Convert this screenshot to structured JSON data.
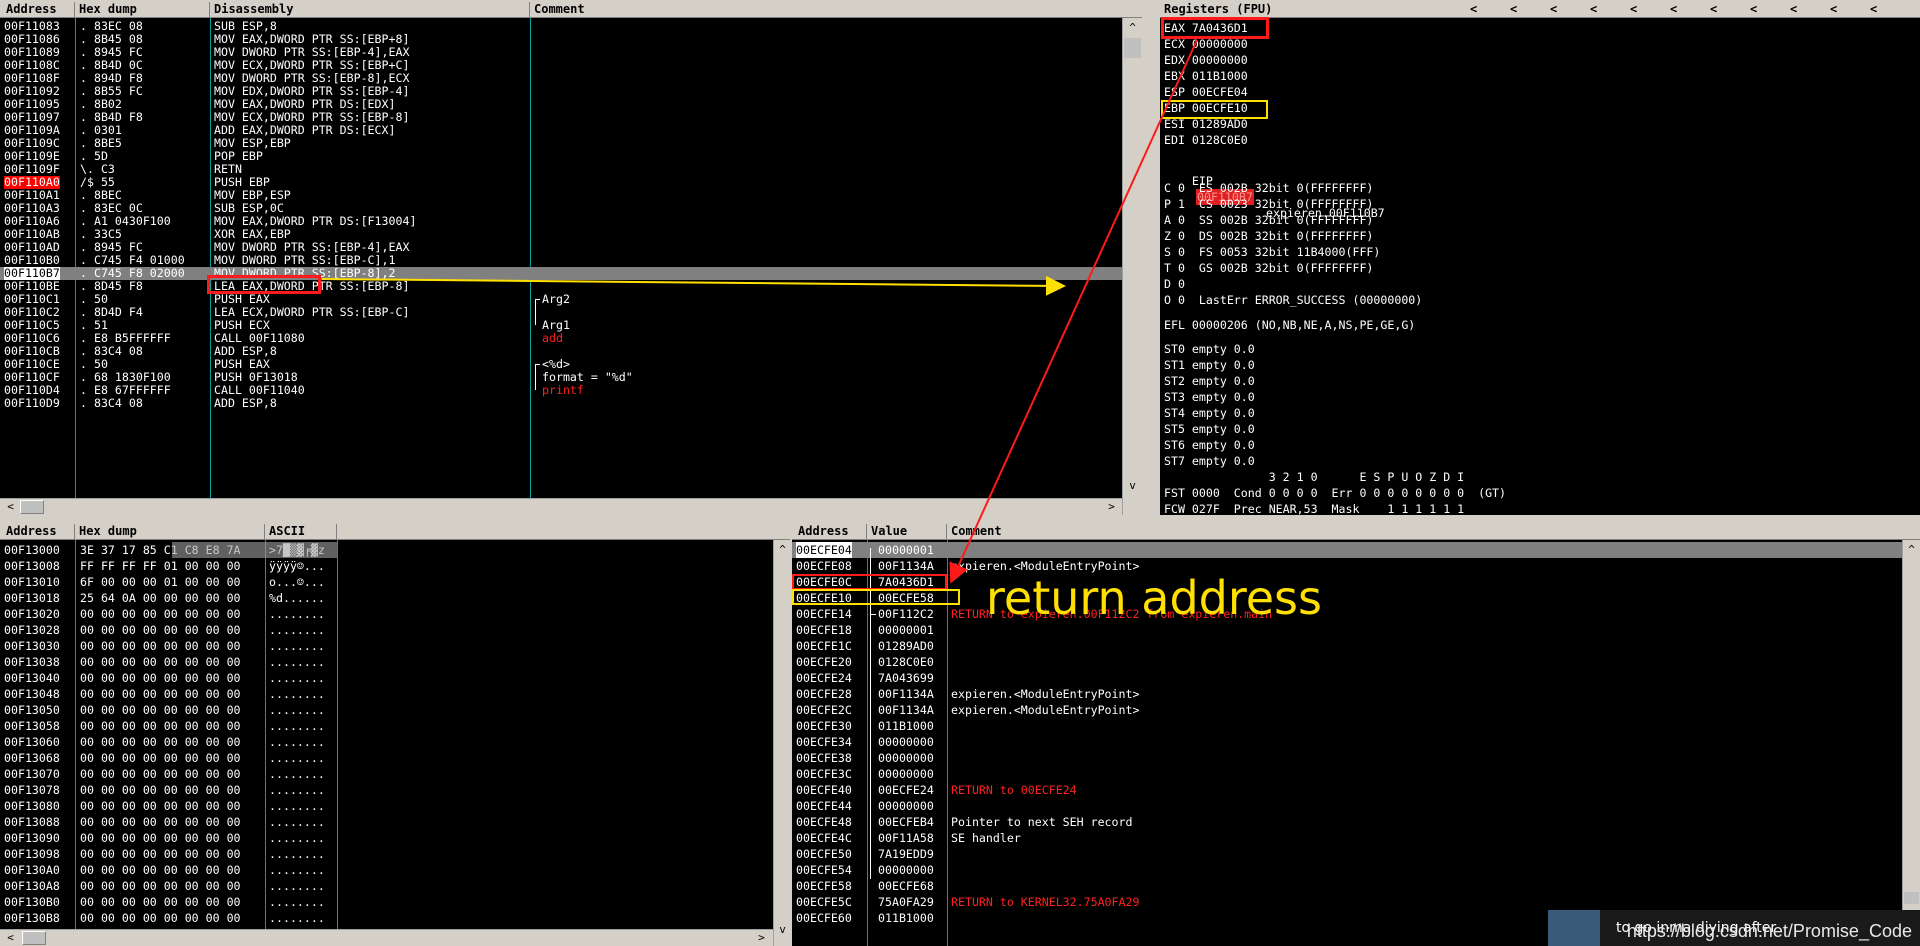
{
  "disasm": {
    "headers": [
      "Address",
      "Hex dump",
      "Disassembly",
      "Comment"
    ],
    "rows": [
      {
        "addr": "00F11083",
        "hex": ". 83EC 08",
        "asm": "SUB ESP,8",
        "comment": ""
      },
      {
        "addr": "00F11086",
        "hex": ". 8B45 08",
        "asm": "MOV EAX,DWORD PTR SS:[EBP+8]",
        "comment": ""
      },
      {
        "addr": "00F11089",
        "hex": ". 8945 FC",
        "asm": "MOV DWORD PTR SS:[EBP-4],EAX",
        "comment": ""
      },
      {
        "addr": "00F1108C",
        "hex": ". 8B4D 0C",
        "asm": "MOV ECX,DWORD PTR SS:[EBP+C]",
        "comment": ""
      },
      {
        "addr": "00F1108F",
        "hex": ". 894D F8",
        "asm": "MOV DWORD PTR SS:[EBP-8],ECX",
        "comment": ""
      },
      {
        "addr": "00F11092",
        "hex": ". 8B55 FC",
        "asm": "MOV EDX,DWORD PTR SS:[EBP-4]",
        "comment": ""
      },
      {
        "addr": "00F11095",
        "hex": ". 8B02",
        "asm": "MOV EAX,DWORD PTR DS:[EDX]",
        "comment": ""
      },
      {
        "addr": "00F11097",
        "hex": ". 8B4D F8",
        "asm": "MOV ECX,DWORD PTR SS:[EBP-8]",
        "comment": ""
      },
      {
        "addr": "00F1109A",
        "hex": ". 0301",
        "asm": "ADD EAX,DWORD PTR DS:[ECX]",
        "comment": ""
      },
      {
        "addr": "00F1109C",
        "hex": ". 8BE5",
        "asm": "MOV ESP,EBP",
        "comment": ""
      },
      {
        "addr": "00F1109E",
        "hex": ". 5D",
        "asm": "POP EBP",
        "comment": ""
      },
      {
        "addr": "00F1109F",
        "hex": "\\. C3",
        "asm": "RETN",
        "comment": ""
      },
      {
        "addr": "00F110A0",
        "hex": "/$ 55",
        "asm": "PUSH EBP",
        "comment": ""
      },
      {
        "addr": "00F110A1",
        "hex": ". 8BEC",
        "asm": "MOV EBP,ESP",
        "comment": ""
      },
      {
        "addr": "00F110A3",
        "hex": ". 83EC 0C",
        "asm": "SUB ESP,0C",
        "comment": ""
      },
      {
        "addr": "00F110A6",
        "hex": ". A1 0430F100",
        "asm": "MOV EAX,DWORD PTR DS:[F13004]",
        "comment": ""
      },
      {
        "addr": "00F110AB",
        "hex": ". 33C5",
        "asm": "XOR EAX,EBP",
        "comment": ""
      },
      {
        "addr": "00F110AD",
        "hex": ". 8945 FC",
        "asm": "MOV DWORD PTR SS:[EBP-4],EAX",
        "comment": ""
      },
      {
        "addr": "00F110B0",
        "hex": ". C745 F4 01000",
        "asm": "MOV DWORD PTR SS:[EBP-C],1",
        "comment": ""
      },
      {
        "addr": "00F110B7",
        "hex": ". C745 F8 02000",
        "asm": "MOV DWORD PTR SS:[EBP-8],2",
        "comment": ""
      },
      {
        "addr": "00F110BE",
        "hex": ". 8D45 F8",
        "asm": "LEA EAX,DWORD PTR SS:[EBP-8]",
        "comment": ""
      },
      {
        "addr": "00F110C1",
        "hex": ". 50",
        "asm": "PUSH EAX",
        "comment": "Arg2"
      },
      {
        "addr": "00F110C2",
        "hex": ". 8D4D F4",
        "asm": "LEA ECX,DWORD PTR SS:[EBP-C]",
        "comment": ""
      },
      {
        "addr": "00F110C5",
        "hex": ". 51",
        "asm": "PUSH ECX",
        "comment": "Arg1"
      },
      {
        "addr": "00F110C6",
        "hex": ". E8 B5FFFFFF",
        "asm": "CALL 00F11080",
        "comment": "add"
      },
      {
        "addr": "00F110CB",
        "hex": ". 83C4 08",
        "asm": "ADD ESP,8",
        "comment": ""
      },
      {
        "addr": "00F110CE",
        "hex": ". 50",
        "asm": "PUSH EAX",
        "comment": "<%d>"
      },
      {
        "addr": "00F110CF",
        "hex": ". 68 1830F100",
        "asm": "PUSH 0F13018",
        "comment": "format = \"%d\""
      },
      {
        "addr": "00F110D4",
        "hex": ". E8 67FFFFFF",
        "asm": "CALL 00F11040",
        "comment": "printf"
      },
      {
        "addr": "00F110D9",
        "hex": ". 83C4 08",
        "asm": "ADD ESP,8",
        "comment": ""
      }
    ]
  },
  "registers": {
    "title": "Registers (FPU)",
    "nav_arrows": [
      "<",
      "<",
      "<",
      "<",
      "<",
      "<",
      "<",
      "<",
      "<",
      "<",
      "<"
    ],
    "gp": [
      "EAX 7A0436D1",
      "ECX 00000000",
      "EDX 00000000",
      "EBX 011B1000",
      "ESP 00ECFE04",
      "EBP 00ECFE10",
      "ESI 01289AD0",
      "EDI 0128C0E0"
    ],
    "eip_label": "EIP",
    "eip_value": "00F110B7",
    "eip_comment": "expieren.00F110B7",
    "flags": [
      "C 0  ES 002B 32bit 0(FFFFFFFF)",
      "P 1  CS 0023 32bit 0(FFFFFFFF)",
      "A 0  SS 002B 32bit 0(FFFFFFFF)",
      "Z 0  DS 002B 32bit 0(FFFFFFFF)",
      "S 0  FS 0053 32bit 11B4000(FFF)",
      "T 0  GS 002B 32bit 0(FFFFFFFF)",
      "D 0",
      "O 0  LastErr ERROR_SUCCESS (00000000)"
    ],
    "efl": "EFL 00000206 (NO,NB,NE,A,NS,PE,GE,G)",
    "fpu": [
      "ST0 empty 0.0",
      "ST1 empty 0.0",
      "ST2 empty 0.0",
      "ST3 empty 0.0",
      "ST4 empty 0.0",
      "ST5 empty 0.0",
      "ST6 empty 0.0",
      "ST7 empty 0.0"
    ],
    "fpu_hdr": "               3 2 1 0      E S P U O Z D I",
    "fst": "FST 0000  Cond 0 0 0 0  Err 0 0 0 0 0 0 0 0  (GT)",
    "fcw": "FCW 027F  Prec NEAR,53  Mask    1 1 1 1 1 1"
  },
  "hexdump": {
    "headers": [
      "Address",
      "Hex dump",
      "ASCII"
    ],
    "rows": [
      {
        "addr": "00F13000",
        "hex": "3E 37 17 85 C1 C8 E8 7A",
        "ascii": ">7█▒▓╒▓z"
      },
      {
        "addr": "00F13008",
        "hex": "FF FF FF FF 01 00 00 00",
        "ascii": "ÿÿÿÿ☺..."
      },
      {
        "addr": "00F13010",
        "hex": "6F 00 00 00 01 00 00 00",
        "ascii": "o...☺..."
      },
      {
        "addr": "00F13018",
        "hex": "25 64 0A 00 00 00 00 00",
        "ascii": "%d......"
      },
      {
        "addr": "00F13020",
        "hex": "00 00 00 00 00 00 00 00",
        "ascii": "........"
      },
      {
        "addr": "00F13028",
        "hex": "00 00 00 00 00 00 00 00",
        "ascii": "........"
      },
      {
        "addr": "00F13030",
        "hex": "00 00 00 00 00 00 00 00",
        "ascii": "........"
      },
      {
        "addr": "00F13038",
        "hex": "00 00 00 00 00 00 00 00",
        "ascii": "........"
      },
      {
        "addr": "00F13040",
        "hex": "00 00 00 00 00 00 00 00",
        "ascii": "........"
      },
      {
        "addr": "00F13048",
        "hex": "00 00 00 00 00 00 00 00",
        "ascii": "........"
      },
      {
        "addr": "00F13050",
        "hex": "00 00 00 00 00 00 00 00",
        "ascii": "........"
      },
      {
        "addr": "00F13058",
        "hex": "00 00 00 00 00 00 00 00",
        "ascii": "........"
      },
      {
        "addr": "00F13060",
        "hex": "00 00 00 00 00 00 00 00",
        "ascii": "........"
      },
      {
        "addr": "00F13068",
        "hex": "00 00 00 00 00 00 00 00",
        "ascii": "........"
      },
      {
        "addr": "00F13070",
        "hex": "00 00 00 00 00 00 00 00",
        "ascii": "........"
      },
      {
        "addr": "00F13078",
        "hex": "00 00 00 00 00 00 00 00",
        "ascii": "........"
      },
      {
        "addr": "00F13080",
        "hex": "00 00 00 00 00 00 00 00",
        "ascii": "........"
      },
      {
        "addr": "00F13088",
        "hex": "00 00 00 00 00 00 00 00",
        "ascii": "........"
      },
      {
        "addr": "00F13090",
        "hex": "00 00 00 00 00 00 00 00",
        "ascii": "........"
      },
      {
        "addr": "00F13098",
        "hex": "00 00 00 00 00 00 00 00",
        "ascii": "........"
      },
      {
        "addr": "00F130A0",
        "hex": "00 00 00 00 00 00 00 00",
        "ascii": "........"
      },
      {
        "addr": "00F130A8",
        "hex": "00 00 00 00 00 00 00 00",
        "ascii": "........"
      },
      {
        "addr": "00F130B0",
        "hex": "00 00 00 00 00 00 00 00",
        "ascii": "........"
      },
      {
        "addr": "00F130B8",
        "hex": "00 00 00 00 00 00 00 00",
        "ascii": "........"
      }
    ]
  },
  "stack": {
    "headers": [
      "Address",
      "Value",
      "Comment"
    ],
    "rows": [
      {
        "addr": "00ECFE04",
        "val": "00000001",
        "comment": ""
      },
      {
        "addr": "00ECFE08",
        "val": "00F1134A",
        "comment": "expieren.<ModuleEntryPoint>"
      },
      {
        "addr": "00ECFE0C",
        "val": "7A0436D1",
        "comment": ""
      },
      {
        "addr": "00ECFE10",
        "val": "00ECFE58",
        "comment": ""
      },
      {
        "addr": "00ECFE14",
        "val": "00F112C2",
        "comment": "RETURN to expieren.00F112C2 from expieren.main"
      },
      {
        "addr": "00ECFE18",
        "val": "00000001",
        "comment": ""
      },
      {
        "addr": "00ECFE1C",
        "val": "01289AD0",
        "comment": ""
      },
      {
        "addr": "00ECFE20",
        "val": "0128C0E0",
        "comment": ""
      },
      {
        "addr": "00ECFE24",
        "val": "7A043699",
        "comment": ""
      },
      {
        "addr": "00ECFE28",
        "val": "00F1134A",
        "comment": "expieren.<ModuleEntryPoint>"
      },
      {
        "addr": "00ECFE2C",
        "val": "00F1134A",
        "comment": "expieren.<ModuleEntryPoint>"
      },
      {
        "addr": "00ECFE30",
        "val": "011B1000",
        "comment": ""
      },
      {
        "addr": "00ECFE34",
        "val": "00000000",
        "comment": ""
      },
      {
        "addr": "00ECFE38",
        "val": "00000000",
        "comment": ""
      },
      {
        "addr": "00ECFE3C",
        "val": "00000000",
        "comment": ""
      },
      {
        "addr": "00ECFE40",
        "val": "00ECFE24",
        "comment": "RETURN to 00ECFE24"
      },
      {
        "addr": "00ECFE44",
        "val": "00000000",
        "comment": ""
      },
      {
        "addr": "00ECFE48",
        "val": "00ECFEB4",
        "comment": "Pointer to next SEH record"
      },
      {
        "addr": "00ECFE4C",
        "val": "00F11A58",
        "comment": "SE handler"
      },
      {
        "addr": "00ECFE50",
        "val": "7A19EDD9",
        "comment": ""
      },
      {
        "addr": "00ECFE54",
        "val": "00000000",
        "comment": ""
      },
      {
        "addr": "00ECFE58",
        "val": "00ECFE68",
        "comment": ""
      },
      {
        "addr": "00ECFE5C",
        "val": "75A0FA29",
        "comment": "RETURN to KERNEL32.75A0FA29"
      },
      {
        "addr": "00ECFE60",
        "val": "011B1000",
        "comment": ""
      }
    ]
  },
  "annotation": {
    "text": "return address"
  },
  "watermark": "https://blog.csdn.net/Promise_Code",
  "video_caption": "to go inma diying after",
  "colors": {
    "accent_red": "#ff1a1a",
    "accent_yellow": "#ffe000",
    "panel_bg": "#000000",
    "chrome": "#d4d0c8"
  }
}
